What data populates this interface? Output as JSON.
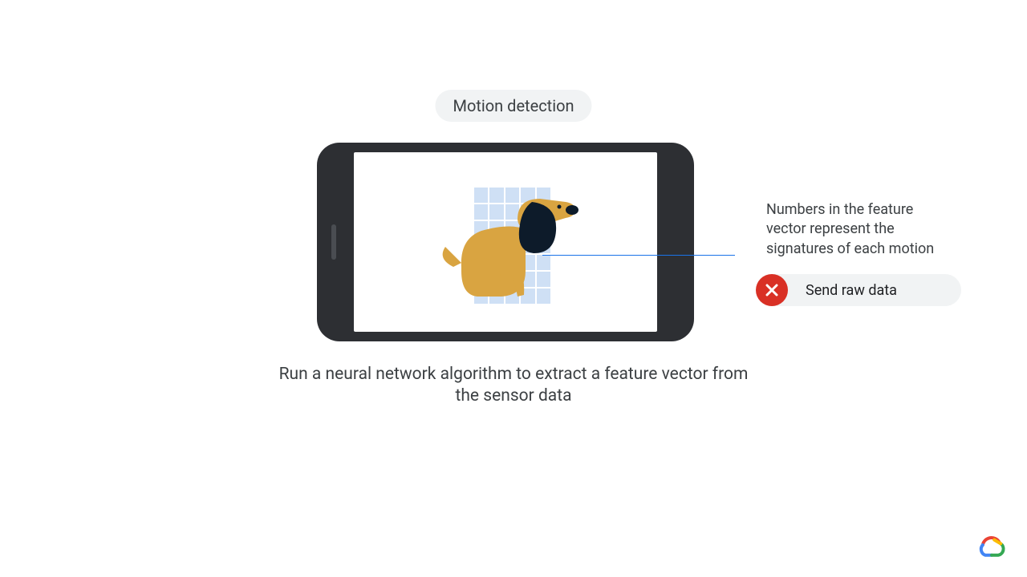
{
  "header": {
    "pill_label": "Motion detection"
  },
  "caption": "Run a neural network algorithm to extract a feature vector from the sensor data",
  "annotation": {
    "text": "Numbers in the feature vector represent the signatures of each motion"
  },
  "option": {
    "status": "rejected",
    "label": "Send raw data"
  },
  "illustration": {
    "subject": "dog",
    "overlay": "pixel-grid"
  },
  "brand": {
    "icon": "google-cloud"
  },
  "colors": {
    "pill_bg": "#f1f3f4",
    "badge_bg": "#d93025",
    "line": "#1a73e8"
  }
}
